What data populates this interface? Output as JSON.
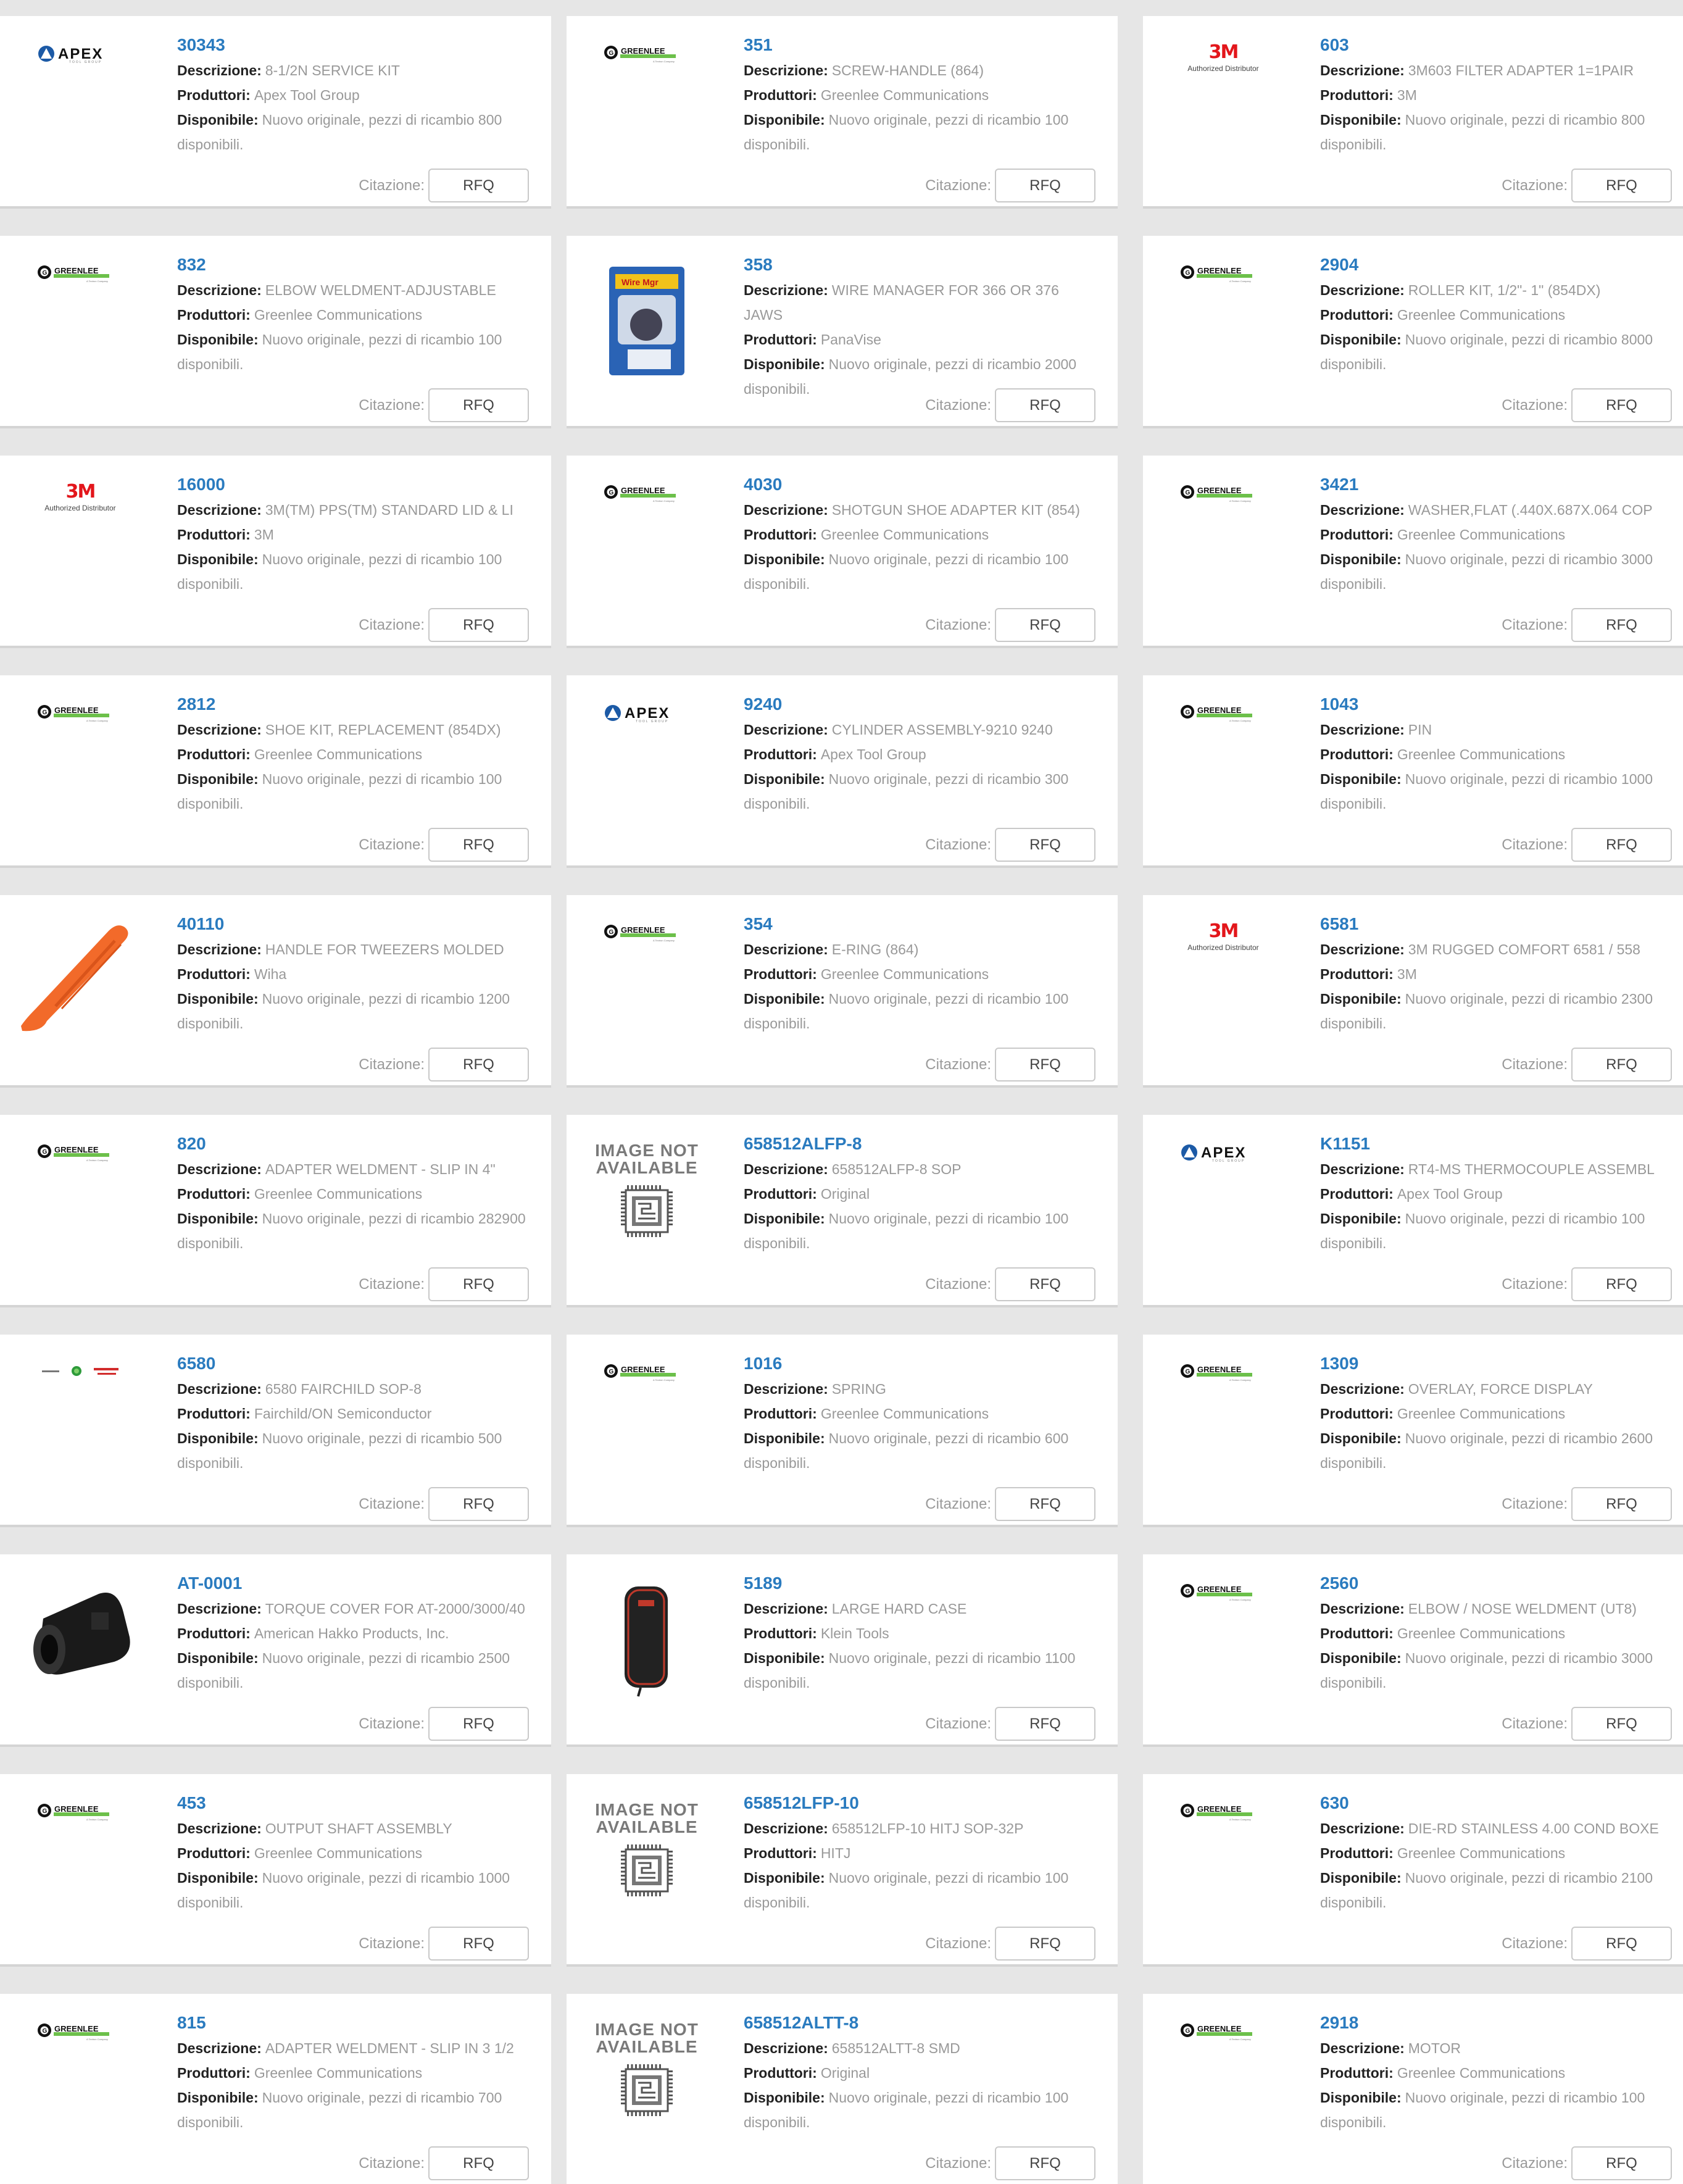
{
  "labels": {
    "descrizione": "Descrizione:",
    "produttori": "Produttori:",
    "disponibile": "Disponibile:",
    "citazione": "Citazione:",
    "rfq": "RFQ",
    "image_not_available_1": "IMAGE NOT",
    "image_not_available_2": "AVAILABLE",
    "apex": "APEX",
    "greenlee": "GREENLEE",
    "threem": "3M",
    "threem_sub": "Authorized Distributor"
  },
  "colors": {
    "part_link": "#2a7bbf",
    "background": "#e6e6e6",
    "apex_blue": "#1c5aa6",
    "greenlee_green": "#6cc04a",
    "threem_red": "#e3161b",
    "tweezers_orange": "#f26a2a"
  },
  "products": [
    {
      "part": "30343",
      "desc": "8-1/2N SERVICE KIT",
      "maker": "Apex Tool Group",
      "avail": "Nuovo originale, pezzi di ricambio 800 disponibili.",
      "logo": "apex-logo"
    },
    {
      "part": "351",
      "desc": "SCREW-HANDLE (864)",
      "maker": "Greenlee Communications",
      "avail": "Nuovo originale, pezzi di ricambio 100 disponibili.",
      "logo": "greenlee-logo"
    },
    {
      "part": "603",
      "desc": "3M603 FILTER ADAPTER 1=1PAIR",
      "maker": "3M",
      "avail": "Nuovo originale, pezzi di ricambio 800 disponibili.",
      "logo": "3m-logo"
    },
    {
      "part": "832",
      "desc": "ELBOW WELDMENT-ADJUSTABLE",
      "maker": "Greenlee Communications",
      "avail": "Nuovo originale, pezzi di ricambio 100 disponibili.",
      "logo": "greenlee-logo"
    },
    {
      "part": "358",
      "desc": "WIRE MANAGER FOR 366 OR 376 JAWS",
      "maker": "PanaVise",
      "avail": "Nuovo originale, pezzi di ricambio 2000 disponibili.",
      "logo": "wire-manager-photo"
    },
    {
      "part": "2904",
      "desc": "ROLLER KIT, 1/2\"- 1\" (854DX)",
      "maker": "Greenlee Communications",
      "avail": "Nuovo originale, pezzi di ricambio 8000 disponibili.",
      "logo": "greenlee-logo"
    },
    {
      "part": "16000",
      "desc": "3M(TM) PPS(TM) STANDARD LID & LI",
      "maker": "3M",
      "avail": "Nuovo originale, pezzi di ricambio 100 disponibili.",
      "logo": "3m-logo"
    },
    {
      "part": "4030",
      "desc": "SHOTGUN SHOE ADAPTER KIT (854)",
      "maker": "Greenlee Communications",
      "avail": "Nuovo originale, pezzi di ricambio 100 disponibili.",
      "logo": "greenlee-logo"
    },
    {
      "part": "3421",
      "desc": "WASHER,FLAT (.440X.687X.064 COP",
      "maker": "Greenlee Communications",
      "avail": "Nuovo originale, pezzi di ricambio 3000 disponibili.",
      "logo": "greenlee-logo"
    },
    {
      "part": "2812",
      "desc": "SHOE KIT, REPLACEMENT (854DX)",
      "maker": "Greenlee Communications",
      "avail": "Nuovo originale, pezzi di ricambio 100 disponibili.",
      "logo": "greenlee-logo"
    },
    {
      "part": "9240",
      "desc": "CYLINDER ASSEMBLY-9210 9240",
      "maker": "Apex Tool Group",
      "avail": "Nuovo originale, pezzi di ricambio 300 disponibili.",
      "logo": "apex-logo"
    },
    {
      "part": "1043",
      "desc": "PIN",
      "maker": "Greenlee Communications",
      "avail": "Nuovo originale, pezzi di ricambio 1000 disponibili.",
      "logo": "greenlee-logo"
    },
    {
      "part": "40110",
      "desc": "HANDLE FOR TWEEZERS MOLDED",
      "maker": "Wiha",
      "avail": "Nuovo originale, pezzi di ricambio 1200 disponibili.",
      "logo": "tweezer-handle-photo"
    },
    {
      "part": "354",
      "desc": "E-RING (864)",
      "maker": "Greenlee Communications",
      "avail": "Nuovo originale, pezzi di ricambio 100 disponibili.",
      "logo": "greenlee-logo"
    },
    {
      "part": "6581",
      "desc": "3M RUGGED COMFORT 6581 / 558",
      "maker": "3M",
      "avail": "Nuovo originale, pezzi di ricambio 2300 disponibili.",
      "logo": "3m-logo"
    },
    {
      "part": "820",
      "desc": "ADAPTER WELDMENT - SLIP IN 4\"",
      "maker": "Greenlee Communications",
      "avail": "Nuovo originale, pezzi di ricambio 282900 disponibili.",
      "logo": "greenlee-logo"
    },
    {
      "part": "658512ALFP-8",
      "desc": "658512ALFP-8   SOP",
      "maker": "Original",
      "avail": "Nuovo originale, pezzi di ricambio 100 disponibili.",
      "logo": "image-not-available"
    },
    {
      "part": "K1151",
      "desc": "RT4-MS THERMOCOUPLE ASSEMBL",
      "maker": "Apex Tool Group",
      "avail": "Nuovo originale, pezzi di ricambio 100 disponibili.",
      "logo": "apex-logo"
    },
    {
      "part": "6580",
      "desc": "6580 FAIRCHILD SOP-8",
      "maker": "Fairchild/ON Semiconductor",
      "avail": "Nuovo originale, pezzi di ricambio 500 disponibili.",
      "logo": "fairchild-logo"
    },
    {
      "part": "1016",
      "desc": "SPRING",
      "maker": "Greenlee Communications",
      "avail": "Nuovo originale, pezzi di ricambio 600 disponibili.",
      "logo": "greenlee-logo"
    },
    {
      "part": "1309",
      "desc": "OVERLAY, FORCE DISPLAY",
      "maker": "Greenlee Communications",
      "avail": "Nuovo originale, pezzi di ricambio 2600 disponibili.",
      "logo": "greenlee-logo"
    },
    {
      "part": "AT-0001",
      "desc": "TORQUE COVER FOR AT-2000/3000/40",
      "maker": "American Hakko Products, Inc.",
      "avail": "Nuovo originale, pezzi di ricambio 2500 disponibili.",
      "logo": "torque-cover-photo"
    },
    {
      "part": "5189",
      "desc": "LARGE HARD CASE",
      "maker": "Klein Tools",
      "avail": "Nuovo originale, pezzi di ricambio 1100 disponibili.",
      "logo": "hard-case-photo"
    },
    {
      "part": "2560",
      "desc": "ELBOW / NOSE WELDMENT (UT8)",
      "maker": "Greenlee Communications",
      "avail": "Nuovo originale, pezzi di ricambio 3000 disponibili.",
      "logo": "greenlee-logo"
    },
    {
      "part": "453",
      "desc": "OUTPUT SHAFT ASSEMBLY",
      "maker": "Greenlee Communications",
      "avail": "Nuovo originale, pezzi di ricambio 1000 disponibili.",
      "logo": "greenlee-logo"
    },
    {
      "part": "658512LFP-10",
      "desc": "658512LFP-10 HITJ SOP-32P",
      "maker": "HITJ",
      "avail": "Nuovo originale, pezzi di ricambio 100 disponibili.",
      "logo": "image-not-available"
    },
    {
      "part": "630",
      "desc": "DIE-RD STAINLESS 4.00 COND BOXE",
      "maker": "Greenlee Communications",
      "avail": "Nuovo originale, pezzi di ricambio 2100 disponibili.",
      "logo": "greenlee-logo"
    },
    {
      "part": "815",
      "desc": "ADAPTER WELDMENT - SLIP IN 3 1/2",
      "maker": "Greenlee Communications",
      "avail": "Nuovo originale, pezzi di ricambio 700 disponibili.",
      "logo": "greenlee-logo"
    },
    {
      "part": "658512ALTT-8",
      "desc": "658512ALTT-8   SMD",
      "maker": "Original",
      "avail": "Nuovo originale, pezzi di ricambio 100 disponibili.",
      "logo": "image-not-available"
    },
    {
      "part": "2918",
      "desc": "MOTOR",
      "maker": "Greenlee Communications",
      "avail": "Nuovo originale, pezzi di ricambio 100 disponibili.",
      "logo": "greenlee-logo"
    }
  ]
}
